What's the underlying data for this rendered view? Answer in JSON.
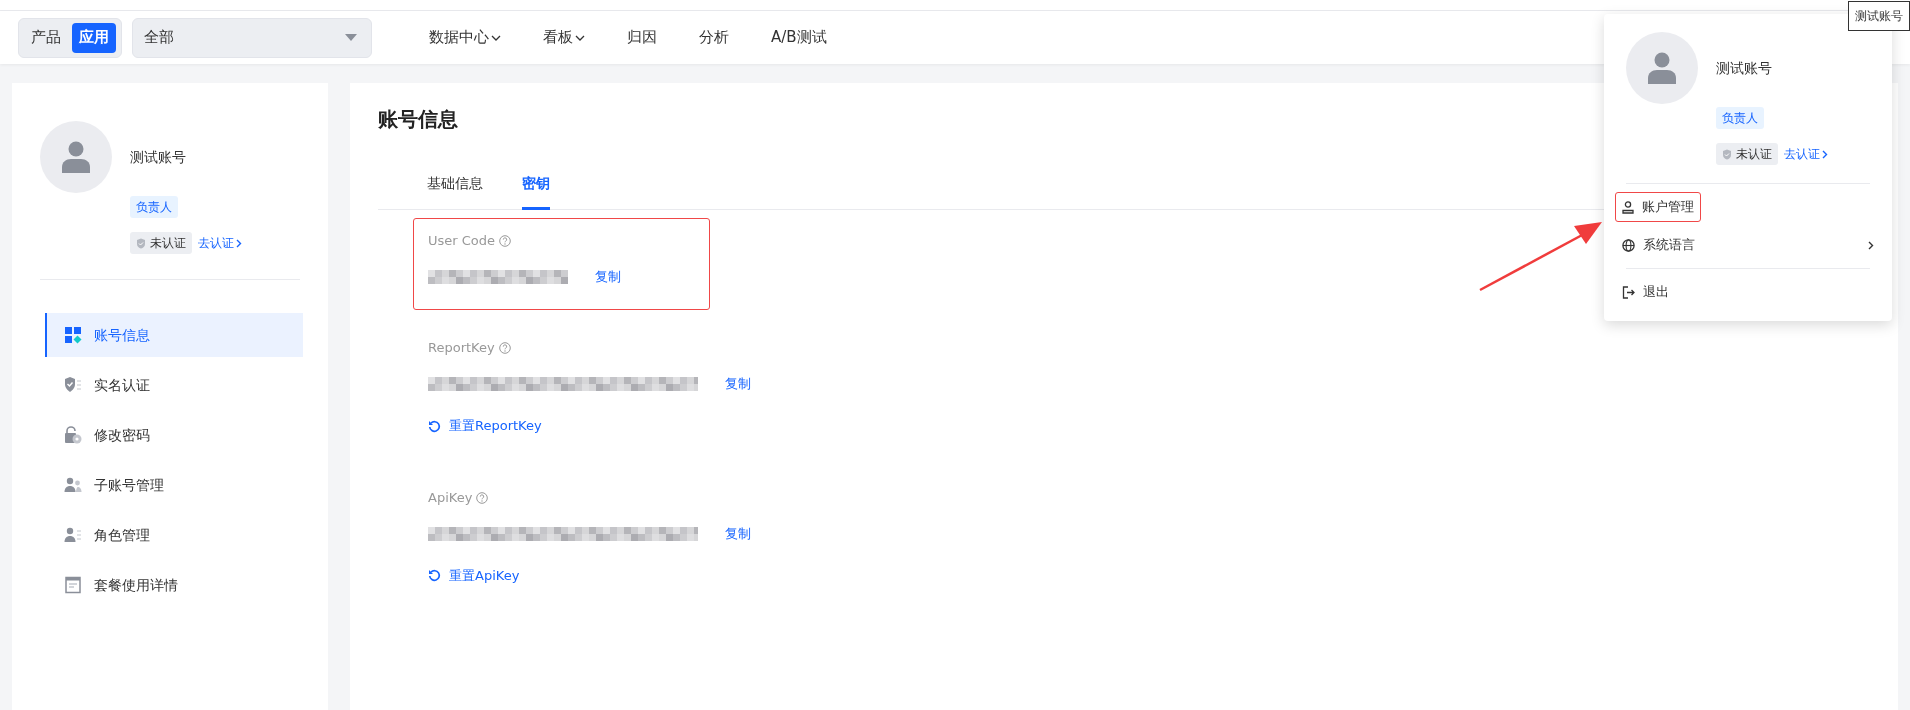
{
  "top_nav": {
    "scope_toggle": [
      {
        "label": "产品",
        "selected": false
      },
      {
        "label": "应用",
        "selected": true
      }
    ],
    "scope_select": {
      "value": "全部"
    },
    "menu": [
      {
        "label": "数据中心",
        "has_dropdown": true
      },
      {
        "label": "看板",
        "has_dropdown": true
      },
      {
        "label": "归因",
        "has_dropdown": false
      },
      {
        "label": "分析",
        "has_dropdown": false
      },
      {
        "label": "A/B测试",
        "has_dropdown": false
      }
    ]
  },
  "profile": {
    "name": "测试账号",
    "role": "负责人",
    "verification": "未认证",
    "verify_link": "去认证"
  },
  "sidebar": {
    "items": [
      {
        "label": "账号信息",
        "kind": "grid",
        "selected": true
      },
      {
        "label": "实名认证",
        "kind": "shield",
        "selected": false
      },
      {
        "label": "修改密码",
        "kind": "lock",
        "selected": false
      },
      {
        "label": "子账号管理",
        "kind": "people",
        "selected": false
      },
      {
        "label": "角色管理",
        "kind": "roster",
        "selected": false
      },
      {
        "label": "套餐使用详情",
        "kind": "document",
        "selected": false
      }
    ]
  },
  "page": {
    "title": "账号信息",
    "tabs": [
      {
        "label": "基础信息",
        "selected": false
      },
      {
        "label": "密钥",
        "selected": true
      }
    ],
    "keys": [
      {
        "label": "User Code",
        "copy": "复制",
        "highlighted": true
      },
      {
        "label": "ReportKey",
        "copy": "复制",
        "reset": "重置ReportKey",
        "highlighted": false
      },
      {
        "label": "ApiKey",
        "copy": "复制",
        "reset": "重置ApiKey",
        "highlighted": false
      }
    ]
  },
  "account_menu": {
    "name": "测试账号",
    "role": "负责人",
    "verification": "未认证",
    "verify_link": "去认证",
    "groups": [
      {
        "items": [
          {
            "label": "账户管理",
            "kind": "person",
            "highlighted": true,
            "submenu": false
          },
          {
            "label": "系统语言",
            "kind": "globe",
            "highlighted": false,
            "submenu": true
          }
        ]
      },
      {
        "items": [
          {
            "label": "退出",
            "kind": "logout",
            "highlighted": false,
            "submenu": false
          }
        ]
      }
    ]
  },
  "tooltip": "测试账号"
}
